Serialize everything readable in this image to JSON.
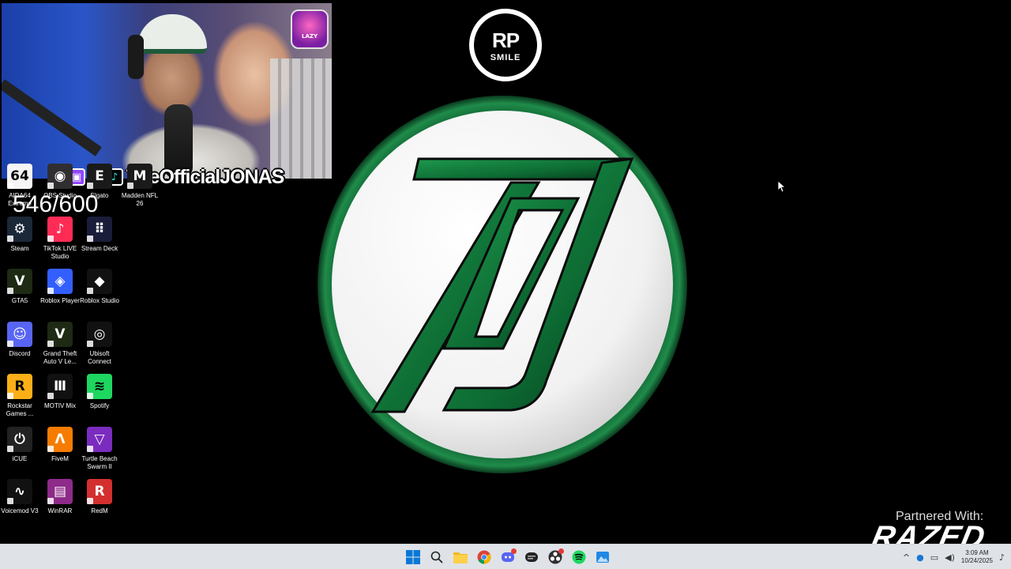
{
  "overlay": {
    "handle": "TheOfficialJONAS",
    "counter": "546/600",
    "webcam_badge_text": "LAZY"
  },
  "desktop_icons": [
    {
      "id": "aida64",
      "label": "AIDA64 Extreme",
      "icon": "aida64-icon",
      "color": "#f5f5f5"
    },
    {
      "id": "obs",
      "label": "OBS Studio",
      "icon": "obs-icon",
      "color": "#302e31"
    },
    {
      "id": "elgato",
      "label": "Elgato",
      "icon": "elgato-icon",
      "color": "#1a1a1a"
    },
    {
      "id": "madden",
      "label": "Madden NFL 26",
      "icon": "madden-icon",
      "color": "#1a1a1a"
    },
    {
      "id": "steam",
      "label": "Steam",
      "icon": "steam-icon",
      "color": "#1b2838"
    },
    {
      "id": "tiktok-live",
      "label": "TikTok LIVE Studio",
      "icon": "tiktok-icon",
      "color": "#fe2c55"
    },
    {
      "id": "stream-deck",
      "label": "Stream Deck",
      "icon": "stream-deck-icon",
      "color": "#1a1d3a"
    },
    {
      "id": "gta5",
      "label": "GTA5",
      "icon": "gta5-icon",
      "color": "#1e2a14"
    },
    {
      "id": "roblox-player",
      "label": "Roblox Player",
      "icon": "roblox-icon",
      "color": "#335fff"
    },
    {
      "id": "roblox-studio",
      "label": "Roblox Studio",
      "icon": "roblox-studio-icon",
      "color": "#111111"
    },
    {
      "id": "discord",
      "label": "Discord",
      "icon": "discord-icon",
      "color": "#5865f2"
    },
    {
      "id": "gta-v-legacy",
      "label": "Grand Theft Auto V Le...",
      "icon": "gta-v-icon",
      "color": "#1e2a14"
    },
    {
      "id": "ubisoft",
      "label": "Ubisoft Connect",
      "icon": "ubisoft-icon",
      "color": "#111111"
    },
    {
      "id": "rockstar",
      "label": "Rockstar Games ...",
      "icon": "rockstar-icon",
      "color": "#fcaf17"
    },
    {
      "id": "motiv",
      "label": "MOTIV Mix",
      "icon": "motiv-icon",
      "color": "#111111"
    },
    {
      "id": "spotify",
      "label": "Spotify",
      "icon": "spotify-icon",
      "color": "#1ed760"
    },
    {
      "id": "icue",
      "label": "iCUE",
      "icon": "icue-icon",
      "color": "#222222"
    },
    {
      "id": "fivem",
      "label": "FiveM",
      "icon": "fivem-icon",
      "color": "#f57c00"
    },
    {
      "id": "turtle-beach",
      "label": "Turtle Beach Swarm II",
      "icon": "turtle-beach-icon",
      "color": "#7b2cbf"
    },
    {
      "id": "voicemod",
      "label": "Voicemod V3",
      "icon": "voicemod-icon",
      "color": "#111111"
    },
    {
      "id": "winrar",
      "label": "WinRAR",
      "icon": "winrar-icon",
      "color": "#8e2a8a"
    },
    {
      "id": "redm",
      "label": "RedM",
      "icon": "redm-icon",
      "color": "#d32f2f"
    }
  ],
  "logos": {
    "rp_top": "RP",
    "rp_bottom": "SMILE"
  },
  "partner": {
    "text": "Partnered With:",
    "brand": "RAZED"
  },
  "taskbar": {
    "clock_time": "3:09 AM",
    "clock_date": "10/24/2025"
  }
}
